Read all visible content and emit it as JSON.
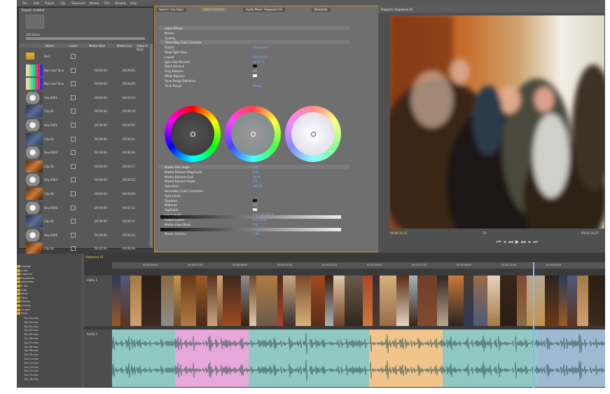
{
  "menu": [
    "File",
    "Edit",
    "Project",
    "Clip",
    "Sequence",
    "Marker",
    "Title",
    "Window",
    "Help"
  ],
  "project": {
    "tab": "Project: Untitled",
    "info": "150 items",
    "headers": [
      "Name",
      "Label",
      "Media Start",
      "Media End",
      "Video In Point"
    ],
    "rows": [
      {
        "name": "Bins",
        "kind": "folder",
        "c1": "",
        "c2": ""
      },
      {
        "name": "Bars and Tone",
        "kind": "bars",
        "c1": "00:00:00",
        "c2": "00:00:05"
      },
      {
        "name": "Bars and Tone",
        "kind": "bars",
        "c1": "00:00:00",
        "c2": "00:00:05"
      },
      {
        "name": "Seq 0001",
        "kind": "seq",
        "c1": "00:00:00",
        "c2": "00:02:10"
      },
      {
        "name": "Clip 01",
        "kind": "blue",
        "c1": "00:00:00",
        "c2": "00:00:14"
      },
      {
        "name": "Seq 0002",
        "kind": "seq",
        "c1": "00:00:00",
        "c2": "00:01:05"
      },
      {
        "name": "Clip 02",
        "kind": "blue",
        "c1": "00:00:00",
        "c2": "00:00:21"
      },
      {
        "name": "Seq 0003",
        "kind": "seq",
        "c1": "00:00:00",
        "c2": "00:00:48"
      },
      {
        "name": "Clip 03",
        "kind": "warm",
        "c1": "00:00:00",
        "c2": "00:00:17"
      },
      {
        "name": "Seq 0004",
        "kind": "seq",
        "c1": "00:00:00",
        "c2": "00:00:55"
      },
      {
        "name": "Clip 04",
        "kind": "warm",
        "c1": "00:00:00",
        "c2": "00:00:09"
      },
      {
        "name": "Seq 0005",
        "kind": "seq",
        "c1": "00:00:00",
        "c2": "00:01:12"
      },
      {
        "name": "Clip 05",
        "kind": "blue",
        "c1": "00:00:00",
        "c2": "00:00:11"
      },
      {
        "name": "Seq 0006",
        "kind": "seq",
        "c1": "00:00:00",
        "c2": "00:00:33"
      },
      {
        "name": "Clip 06",
        "kind": "warm",
        "c1": "00:00:00",
        "c2": "00:00:08"
      }
    ]
  },
  "effect": {
    "tabs": [
      "Source: (no clips)",
      "Effect Controls",
      "Audio Mixer: Sequence 01",
      "Metadata"
    ],
    "rows": [
      {
        "label": "Video Effects",
        "val": ""
      },
      {
        "label": "Motion",
        "val": ""
      },
      {
        "label": "Opacity",
        "val": ""
      },
      {
        "label": "Three-Way Color Corrector",
        "val": ""
      },
      {
        "label": "Output",
        "val": "Composite"
      },
      {
        "label": "Show Split View",
        "val": ""
      },
      {
        "label": "Layout",
        "val": "Horizontal"
      },
      {
        "label": "Split View Percent",
        "val": "50.00 %"
      },
      {
        "label": "Black Balance",
        "val": "",
        "sw": "#111111"
      },
      {
        "label": "Gray Balance",
        "val": "",
        "sw": "#888888"
      },
      {
        "label": "White Balance",
        "val": "",
        "sw": "#f2f2f2"
      },
      {
        "label": "Tonal Range Definition",
        "val": ""
      },
      {
        "label": "Tonal Range",
        "val": "Master"
      }
    ],
    "rows2": [
      {
        "label": "Master Hue Angle",
        "val": "0.0"
      },
      {
        "label": "Master Balance Magnitude",
        "val": "0.00"
      },
      {
        "label": "Master Balance Gain",
        "val": "20.00"
      },
      {
        "label": "Master Balance Angle",
        "val": "0.0"
      },
      {
        "label": "Saturation",
        "val": "100.00"
      },
      {
        "label": "Secondary Color Correction",
        "val": ""
      },
      {
        "label": "Auto Levels",
        "val": ""
      },
      {
        "label": "Shadows",
        "val": "",
        "sw": "#111111"
      },
      {
        "label": "Midtones",
        "val": "",
        "sw": "#888888"
      },
      {
        "label": "Highlights",
        "val": "",
        "sw": "#eeeeee"
      },
      {
        "label": "Input Levels",
        "val": "0.0 1.00 255.0"
      },
      {
        "label": "Output Levels",
        "val": "0.0 255.0"
      },
      {
        "label": "Master Input Black",
        "val": "0.0"
      },
      {
        "label": "Master Input White",
        "val": "255.0"
      },
      {
        "label": "Master Gamma",
        "val": "1.00"
      }
    ]
  },
  "program": {
    "tab": "Program: Sequence 01",
    "tc_left": "00;00;21;12",
    "tc_right": "00;03;14;27",
    "fit": "Fit",
    "controls": [
      "⏮",
      "◂",
      "◂◂",
      "▶",
      "▸▸",
      "▸",
      "⏭"
    ]
  },
  "bin": {
    "items": [
      "Footage",
      "Audio",
      "Graphics",
      "Sequences",
      "Interviews",
      "B-Roll",
      "Stills",
      "Music",
      "Titles",
      "Exports",
      "Archive",
      "Scratch",
      "Proxy"
    ],
    "clips": [
      "Clip 01.mov",
      "Clip 02.mov",
      "Clip 03.mov",
      "Clip 04.mov",
      "Clip 05.mov",
      "Clip 06.mov",
      "Clip 07.mov",
      "Clip 08.mov",
      "Clip 09.mov",
      "Clip 10.mov",
      "Clip 11.mov",
      "Clip 12.mov",
      "Clip 13.mov",
      "Clip 14.mov",
      "Clip 15.mov",
      "Clip 16.mov"
    ]
  },
  "timeline": {
    "tab": "Sequence 01",
    "ruler": [
      "00;00;16;00",
      "00;00;32;00",
      "00;00;48;00",
      "00;01;04;02",
      "00;01;20;02",
      "00;01;36;02",
      "00;01;52;02",
      "00;02;08;04",
      "00;02;24;04",
      "00;02;40;04"
    ],
    "video_track": "Video 1",
    "audio_track": "Audio 1"
  },
  "colors": {
    "accent": "#b8963c",
    "link": "#7fb0ff",
    "audio_teal": "#8fc9c2",
    "audio_pink": "#e7a7d9",
    "audio_orange": "#f1c48c"
  }
}
